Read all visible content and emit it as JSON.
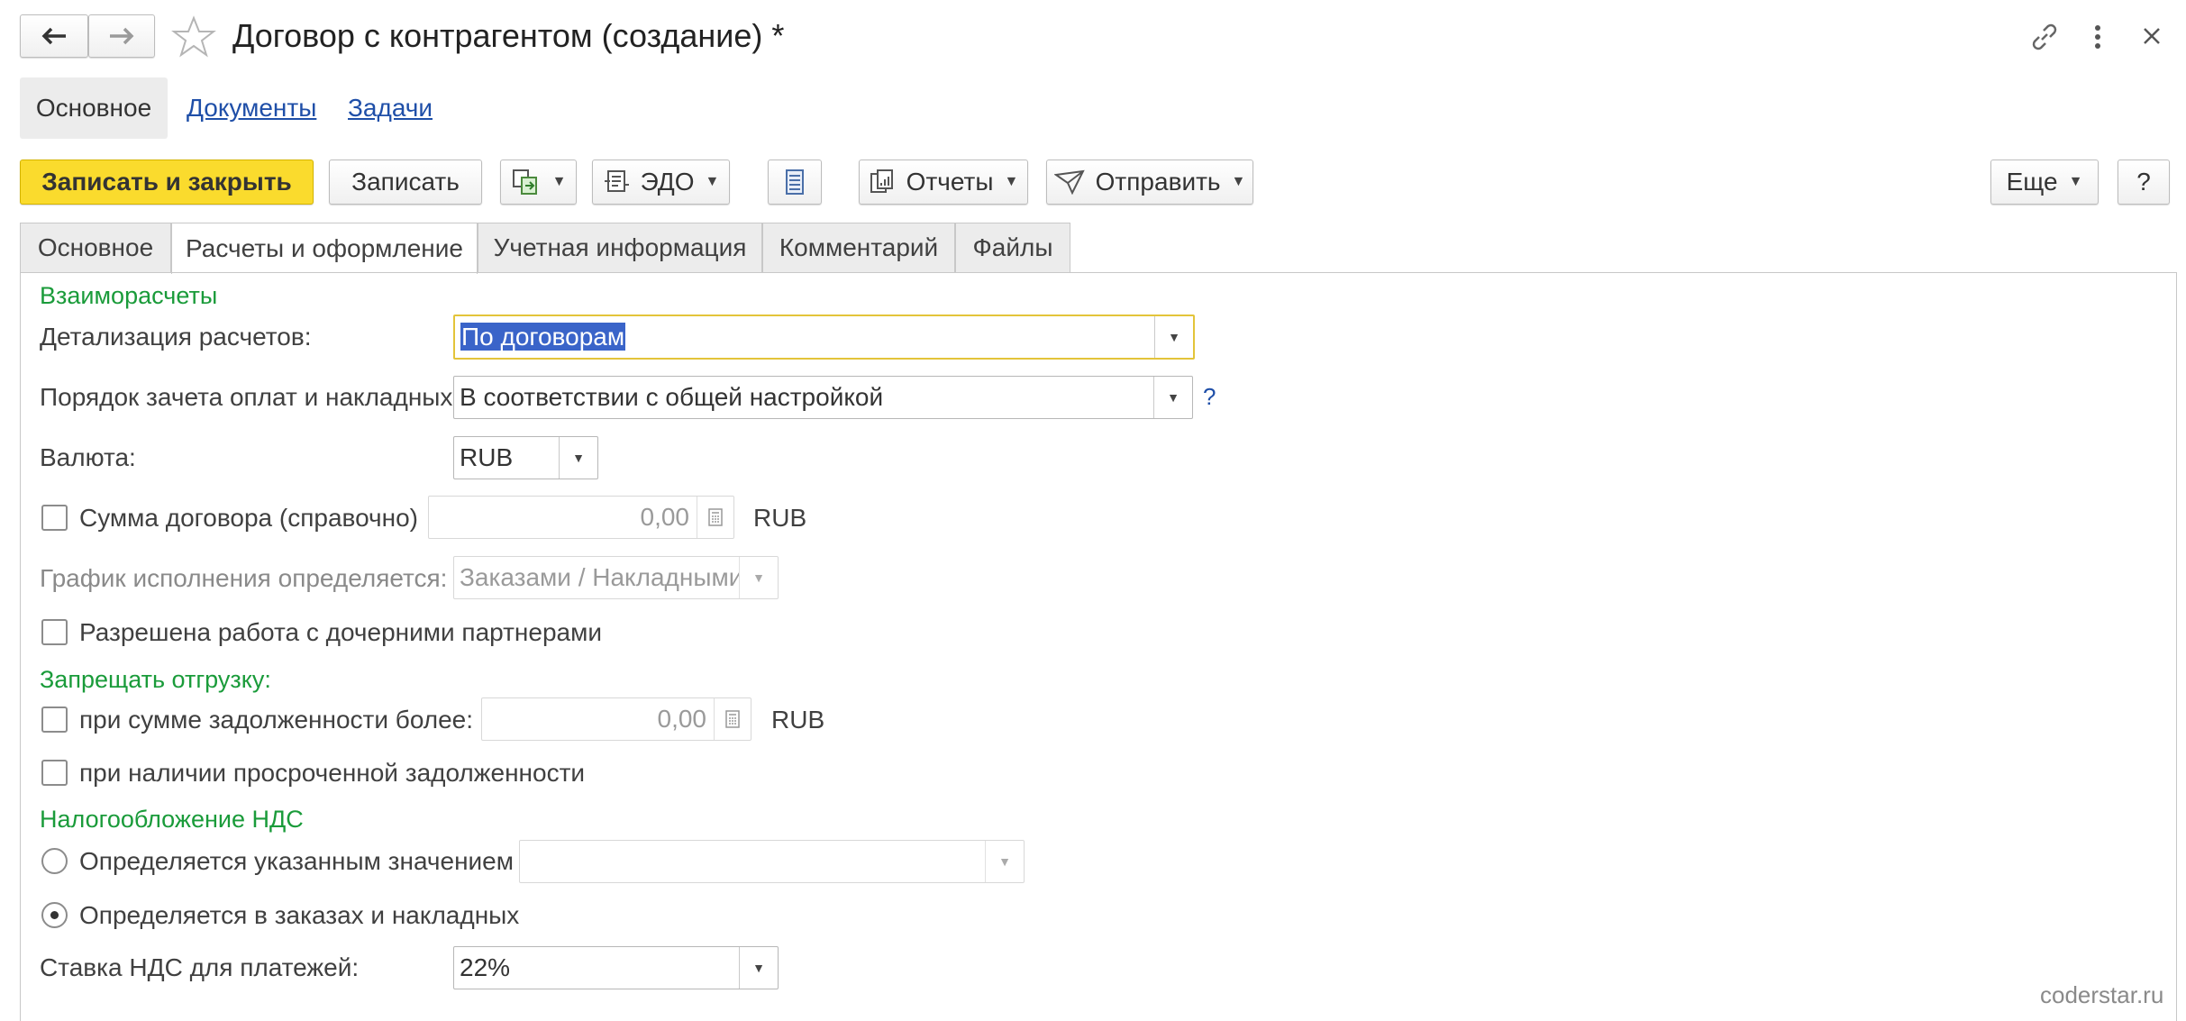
{
  "window": {
    "title": "Договор с контрагентом (создание) *",
    "watermark": "coderstar.ru"
  },
  "nav": {
    "items": [
      {
        "label": "Основное"
      },
      {
        "label": "Документы"
      },
      {
        "label": "Задачи"
      }
    ]
  },
  "toolbar": {
    "save_close": "Записать и закрыть",
    "save": "Записать",
    "edo": "ЭДО",
    "reports": "Отчеты",
    "send": "Отправить",
    "more": "Еще",
    "help": "?"
  },
  "tabs": [
    {
      "label": "Основное"
    },
    {
      "label": "Расчеты и оформление"
    },
    {
      "label": "Учетная информация"
    },
    {
      "label": "Комментарий"
    },
    {
      "label": "Файлы"
    }
  ],
  "form": {
    "section_settlements": "Взаиморасчеты",
    "detail_label": "Детализация расчетов:",
    "detail_value": "По договорам",
    "offset_label": "Порядок зачета оплат и накладных:",
    "offset_value": "В соответствии с общей настройкой",
    "offset_help": "?",
    "currency_label": "Валюта:",
    "currency_value": "RUB",
    "amount_label": "Сумма договора (справочно)",
    "amount_value": "0,00",
    "amount_currency": "RUB",
    "schedule_label": "График исполнения определяется:",
    "schedule_value": "Заказами / Накладными",
    "subsidiary_label": "Разрешена работа с дочерними партнерами",
    "section_forbid": "Запрещать отгрузку:",
    "debt_label": "при сумме задолженности более:",
    "debt_value": "0,00",
    "debt_currency": "RUB",
    "overdue_label": "при наличии просроченной задолженности",
    "section_vat": "Налогообложение НДС",
    "vat_specified_label": "Определяется указанным значением",
    "vat_specified_value": "",
    "vat_orders_label": "Определяется в заказах и накладных",
    "vat_rate_label": "Ставка НДС для платежей:",
    "vat_rate_value": "22%"
  },
  "colors": {
    "accent_yellow": "#fadb2d",
    "section_green": "#1a9b3a",
    "link_blue": "#1f4fa8"
  }
}
